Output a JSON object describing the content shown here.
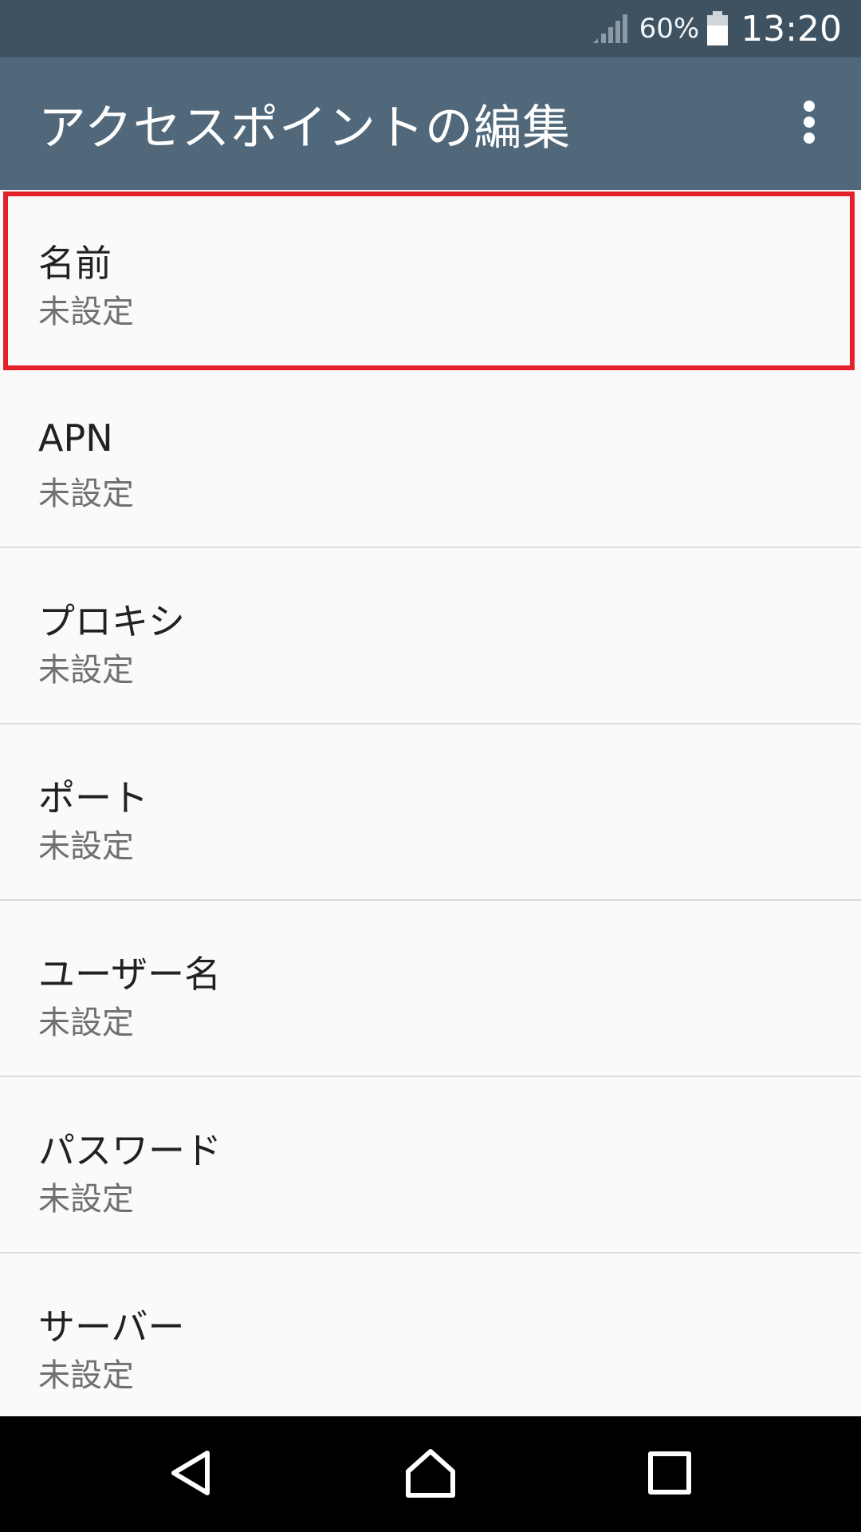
{
  "status_bar": {
    "signal_icon": "cell-signal-icon",
    "battery_percent": "60%",
    "battery_icon": "battery-icon",
    "battery_level": 0.6,
    "time": "13:20"
  },
  "app_bar": {
    "title": "アクセスポイントの編集",
    "overflow_icon": "more-vert-icon"
  },
  "settings": {
    "items": [
      {
        "title": "名前",
        "summary": "未設定",
        "highlighted": true
      },
      {
        "title": "APN",
        "summary": "未設定"
      },
      {
        "title": "プロキシ",
        "summary": "未設定"
      },
      {
        "title": "ポート",
        "summary": "未設定"
      },
      {
        "title": "ユーザー名",
        "summary": "未設定"
      },
      {
        "title": "パスワード",
        "summary": "未設定"
      },
      {
        "title": "サーバー",
        "summary": "未設定"
      }
    ]
  },
  "nav_bar": {
    "back_icon": "back-triangle-icon",
    "home_icon": "home-icon",
    "recents_icon": "recents-square-icon"
  },
  "colors": {
    "status_bar_bg": "#3f5261",
    "app_bar_bg": "#50687a",
    "highlight_border": "#e3212b",
    "list_bg": "#fafafa",
    "divider": "#dcdcdc",
    "nav_bar_bg": "#000000"
  }
}
